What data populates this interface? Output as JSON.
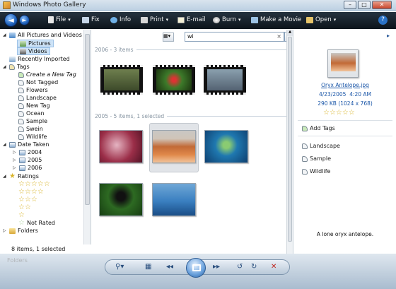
{
  "window": {
    "title": "Windows Photo Gallery",
    "minimize": "–",
    "maximize": "□",
    "close": "✕"
  },
  "toolbar": {
    "back": "◄",
    "forward": "►",
    "items": [
      {
        "label": "File",
        "arrow": "▾",
        "icon": "file-icon",
        "color": "#e7e7e7"
      },
      {
        "label": "Fix",
        "icon": "fix-icon",
        "color": "#c6d6e8"
      },
      {
        "label": "Info",
        "icon": "info-icon",
        "color": "#6fb0e6"
      },
      {
        "label": "Print",
        "arrow": "▾",
        "icon": "print-icon",
        "color": "#d7d7d7"
      },
      {
        "label": "E-mail",
        "icon": "email-icon",
        "color": "#f4f0d6"
      },
      {
        "label": "Burn",
        "arrow": "▾",
        "icon": "burn-icon",
        "color": "#d8d8d8"
      },
      {
        "label": "Make a Movie",
        "icon": "movie-icon",
        "color": "#9cc2e4"
      },
      {
        "label": "Open",
        "arrow": "▾",
        "icon": "open-icon",
        "color": "#e6c46a"
      }
    ],
    "help": "?"
  },
  "sidebar": {
    "all_pictures": "All Pictures and Videos",
    "pictures": "Pictures",
    "videos": "Videos",
    "recently_imported": "Recently Imported",
    "tags": "Tags",
    "tag_items": [
      "Create a New Tag",
      "Not Tagged",
      "Flowers",
      "Landscape",
      "New Tag",
      "Ocean",
      "Sample",
      "Swein",
      "Wildlife"
    ],
    "date_taken": "Date Taken",
    "years": [
      "2004",
      "2005",
      "2006"
    ],
    "ratings": "Ratings",
    "not_rated": "Not Rated",
    "folders": "Folders",
    "expand_open": "◢",
    "expand_closed": "▷"
  },
  "status": "8 items, 1 selected",
  "search": {
    "value": "wi",
    "clear": "×",
    "dropdown": "▾"
  },
  "groups": [
    {
      "label": "2006 - 3 items"
    },
    {
      "label": "2005 - 5 items, 1 selected"
    }
  ],
  "info_pane": {
    "filename": "Oryx Antelope.jpg",
    "date": "4/23/2005",
    "time": "4:20 AM",
    "size": "290 KB (1024 x 768)",
    "add_tags": "Add Tags",
    "tags": [
      "Landscape",
      "Sample",
      "Wildlife"
    ],
    "caption": "A lone oryx antelope.",
    "rating_stars": "☆☆☆☆☆"
  },
  "bottom": {
    "zoom": "⚲▾",
    "grid": "▦",
    "prev": "◂◂",
    "next": "▸▸",
    "rotate_left": "↺",
    "rotate_right": "↻",
    "delete": "✕",
    "ghost": "Folders"
  }
}
